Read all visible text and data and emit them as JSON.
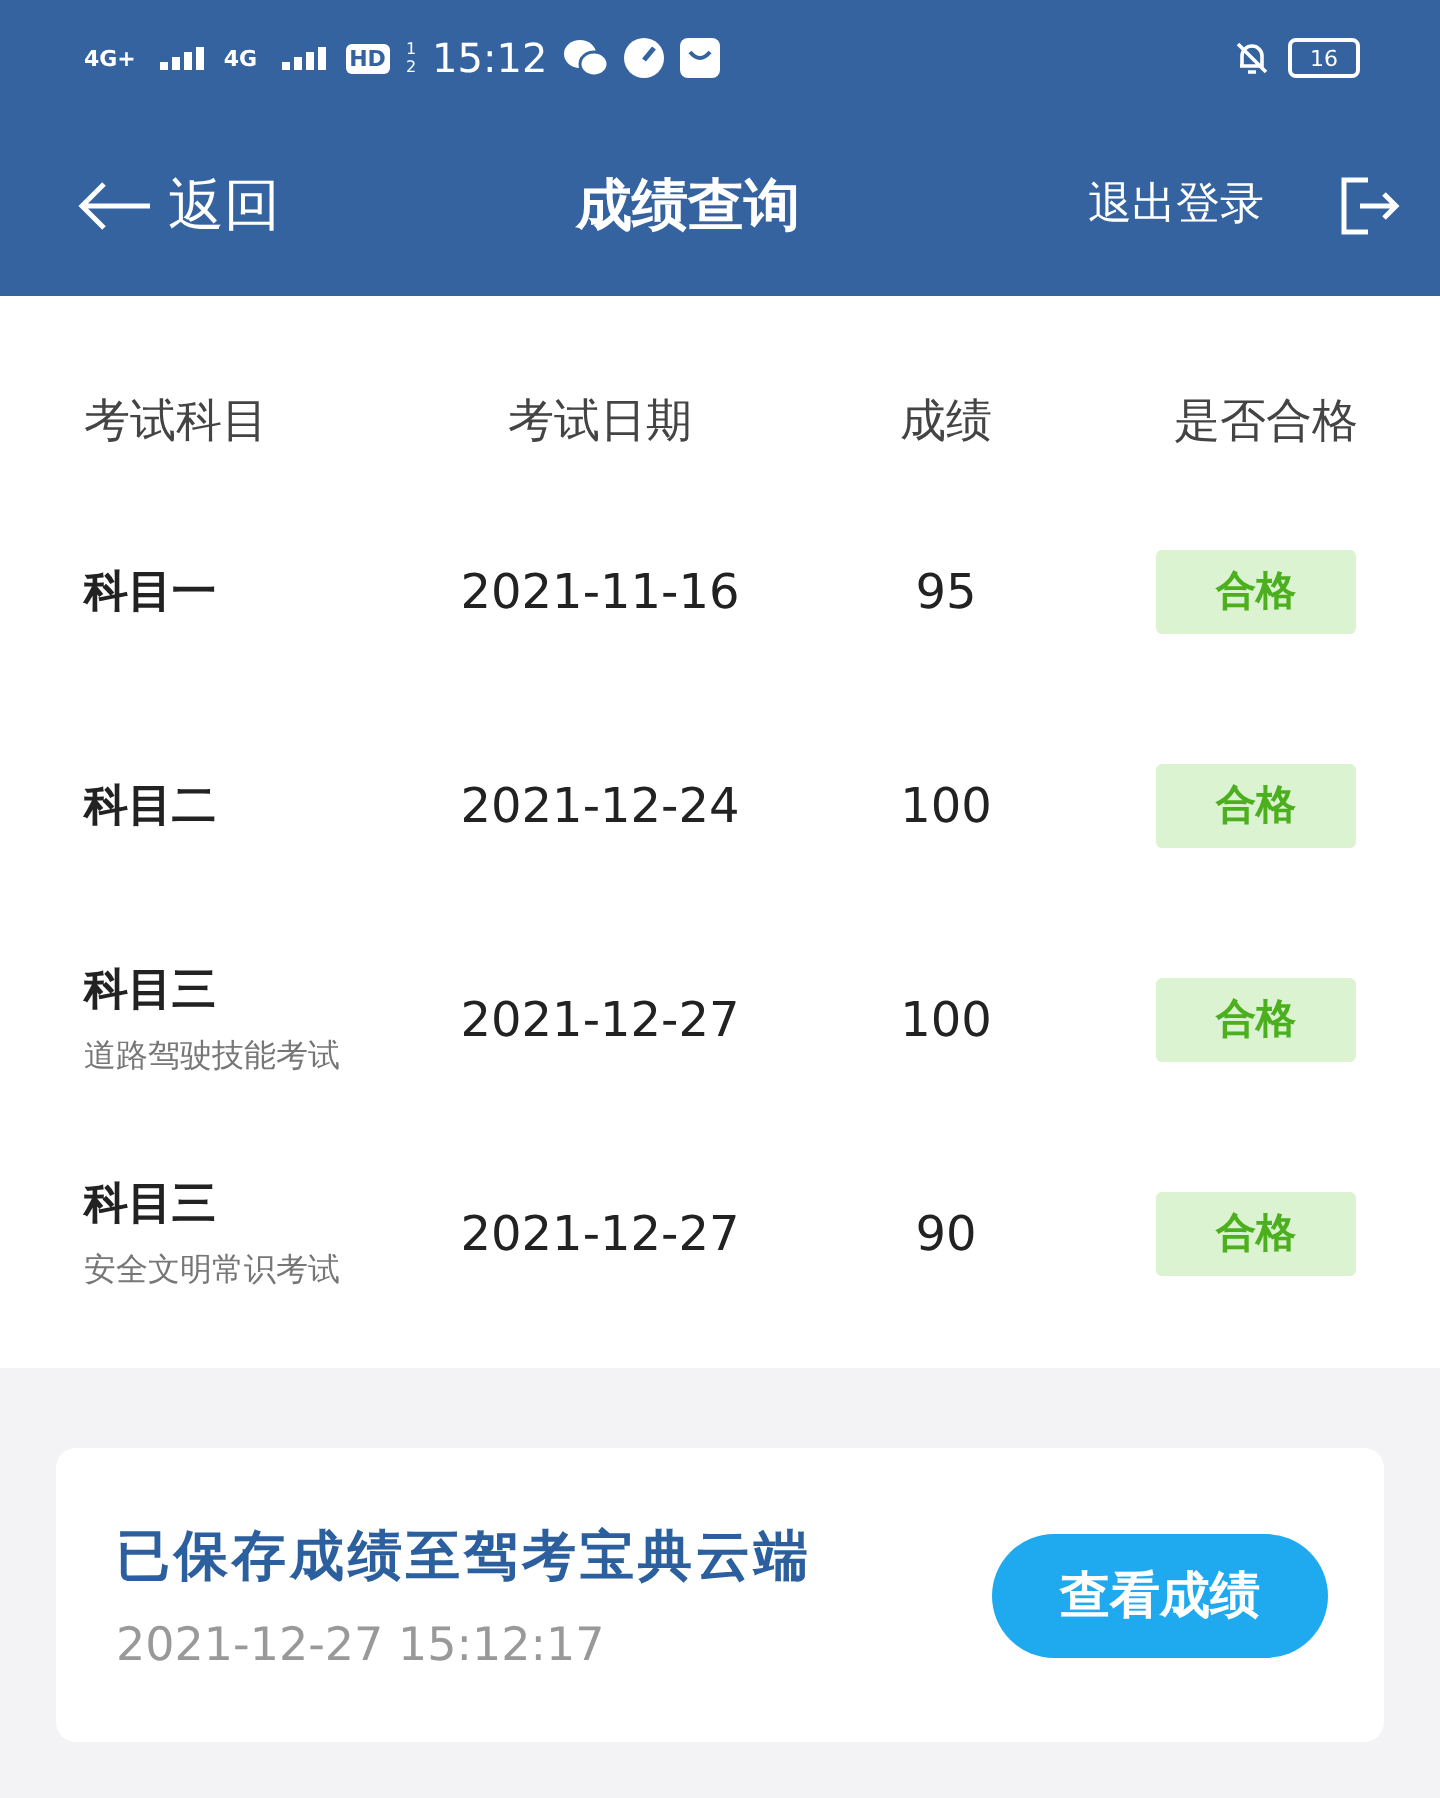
{
  "status_bar": {
    "networks": [
      "4G+",
      "4G"
    ],
    "hd": {
      "label": "HD",
      "slots": [
        "1",
        "2"
      ]
    },
    "time": "15:12",
    "battery": "16"
  },
  "header": {
    "back": "返回",
    "title": "成绩查询",
    "logout": "退出登录"
  },
  "table": {
    "columns": [
      "考试科目",
      "考试日期",
      "成绩",
      "是否合格"
    ],
    "rows": [
      {
        "subject": "科目一",
        "date": "2021-11-16",
        "score": "95",
        "result": "合格",
        "passed": true
      },
      {
        "subject": "科目二",
        "date": "2021-12-24",
        "score": "100",
        "result": "合格",
        "passed": true
      },
      {
        "subject": "科目三",
        "note": "道路驾驶技能考试",
        "date": "2021-12-27",
        "score": "100",
        "result": "合格",
        "passed": true
      },
      {
        "subject": "科目三",
        "note": "安全文明常识考试",
        "date": "2021-12-27",
        "score": "90",
        "result": "合格",
        "passed": true
      }
    ]
  },
  "saved_card": {
    "message": "已保存成绩至驾考宝典云端",
    "time": "2021-12-27 15:12:17",
    "button": "查看成绩"
  }
}
